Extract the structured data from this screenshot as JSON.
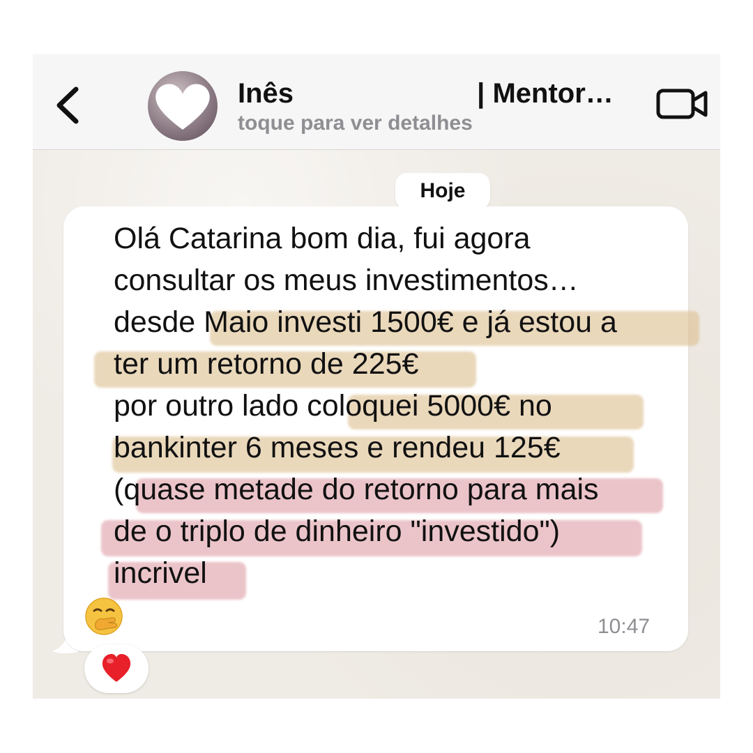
{
  "header": {
    "back_icon": "chevron-left-icon",
    "contact_name_visible": "Inês",
    "contact_name_suffix": "| Mentor…",
    "subtitle": "toque para ver detalhes",
    "video_icon": "video-camera-icon",
    "avatar_icon": "heart-icon"
  },
  "chat": {
    "date_label": "Hoje",
    "message": {
      "lines": [
        "Olá Catarina bom dia, fui agora",
        "consultar os meus investimentos…",
        "desde Maio investi 1500€ e já estou a",
        "ter um retorno de 225€",
        "por outro lado coloquei 5000€ no",
        "bankinter 6 meses e rendeu 125€",
        "(quase metade do retorno para mais",
        "de o triplo de dinheiro \"investido\")",
        "incrivel"
      ],
      "emoji": "🤭",
      "time": "10:47",
      "highlight_colors": {
        "tan": "#ddc092",
        "pink": "#dfa0a8"
      }
    },
    "reaction": {
      "emoji": "❤️",
      "icon": "heart-reaction-icon"
    }
  }
}
